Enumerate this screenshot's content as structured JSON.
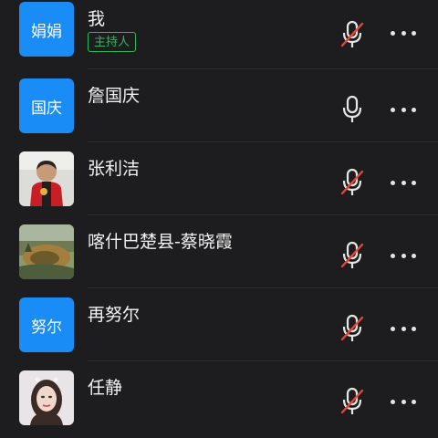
{
  "participants": [
    {
      "name": "我",
      "avatar_text": "娟娟",
      "avatar_type": "text",
      "role": "主持人",
      "mic_icon": "mic-muted-icon"
    },
    {
      "name": "詹国庆",
      "avatar_text": "国庆",
      "avatar_type": "text",
      "role": "",
      "mic_icon": "mic-icon"
    },
    {
      "name": "张利洁",
      "avatar_type": "photo",
      "role": "",
      "mic_icon": "mic-muted-icon"
    },
    {
      "name": "喀什巴楚县-蔡晓霞",
      "avatar_type": "photo",
      "role": "",
      "mic_icon": "mic-muted-icon"
    },
    {
      "name": "再努尔",
      "avatar_text": "努尔",
      "avatar_type": "text",
      "role": "",
      "mic_icon": "mic-muted-icon"
    },
    {
      "name": "任静",
      "avatar_type": "photo",
      "role": "",
      "mic_icon": "mic-muted-icon"
    }
  ],
  "colors": {
    "background": "#1d1d1f",
    "avatar_blue": "#1a8cf6",
    "host_green": "#2fb660",
    "muted_red": "#e6453a"
  }
}
